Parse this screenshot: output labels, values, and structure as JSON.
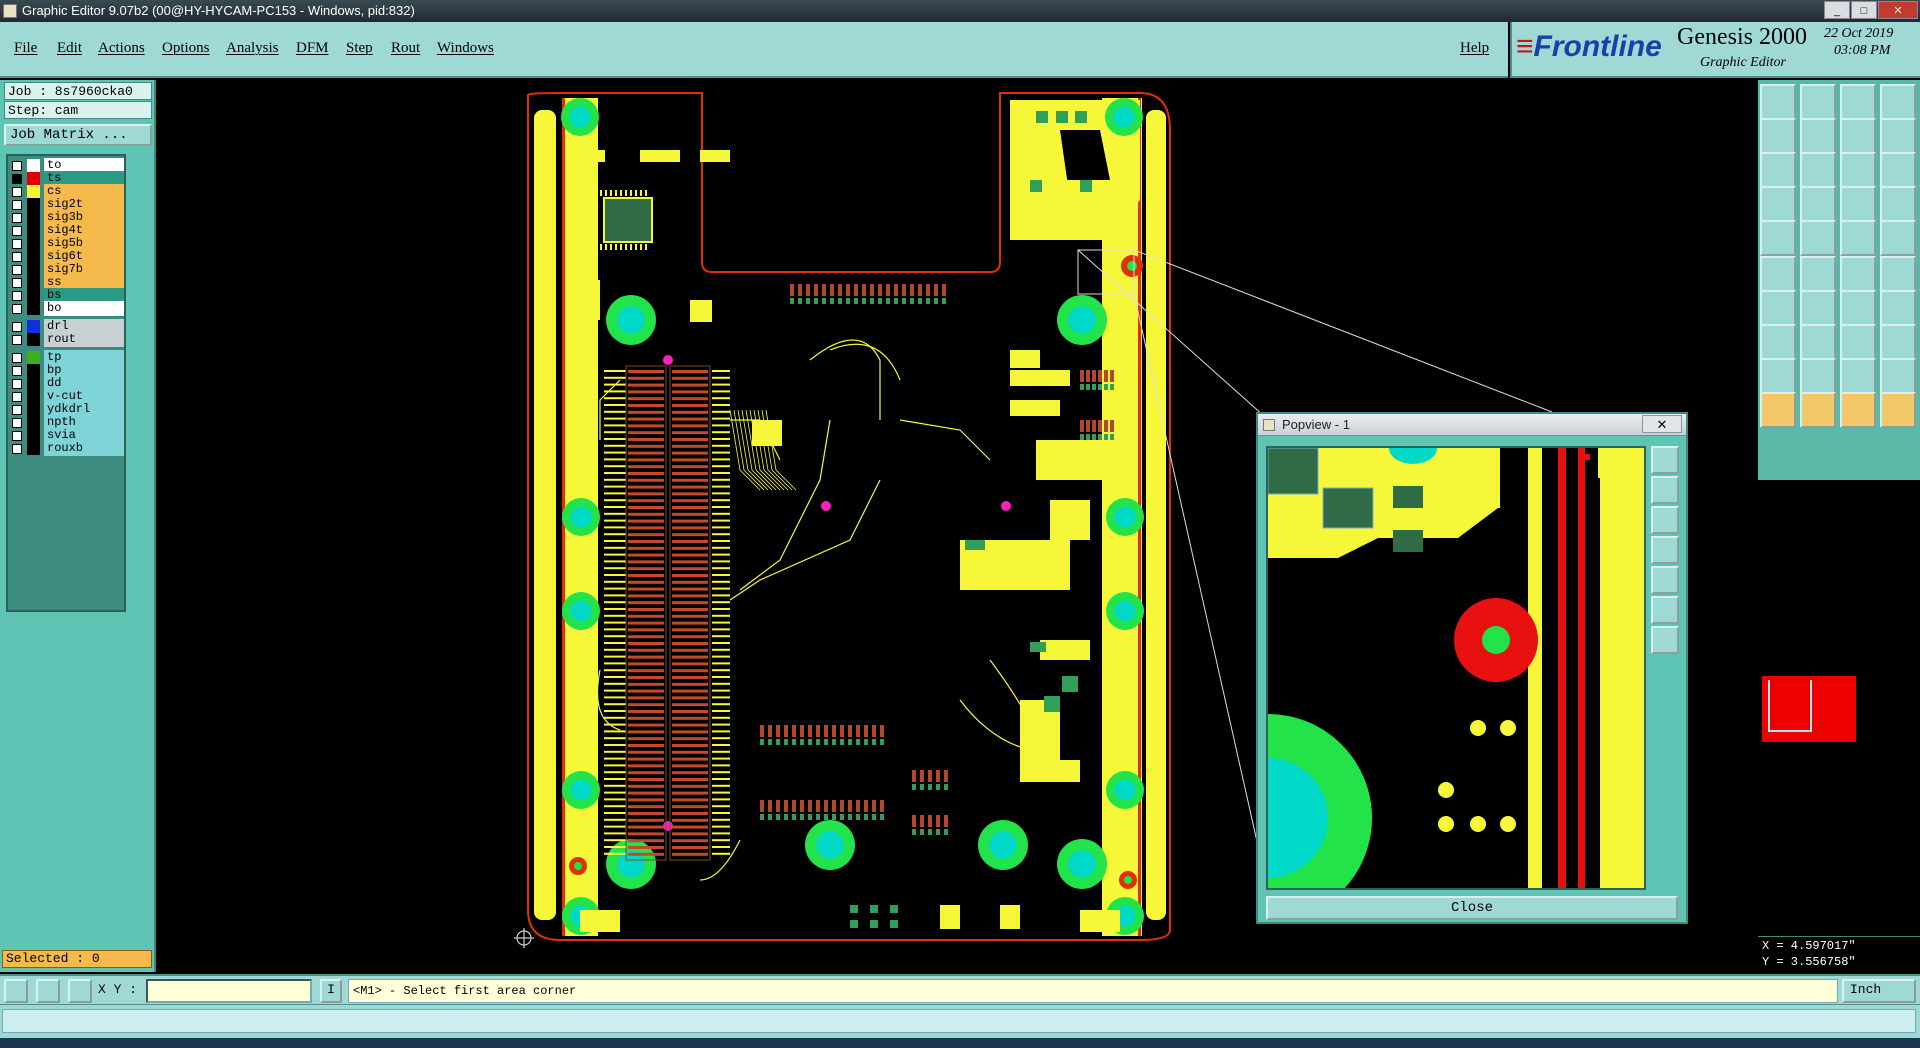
{
  "window": {
    "title": "Graphic Editor 9.07b2 (00@HY-HYCAM-PC153 - Windows, pid:832)",
    "controls": [
      "_",
      "□",
      "✕"
    ]
  },
  "menu": {
    "items": [
      "File",
      "Edit",
      "Actions",
      "Options",
      "Analysis",
      "DFM",
      "Step",
      "Rout",
      "Windows"
    ],
    "help": "Help"
  },
  "brand": {
    "logo": "Frontline",
    "product": "Genesis 2000",
    "subtitle": "Graphic Editor",
    "date": "22 Oct 2019",
    "time": "03:08 PM"
  },
  "job": {
    "job_label": "Job : 8s7960cka0",
    "step_label": "Step: cam",
    "matrix_button": "Job Matrix ..."
  },
  "layers": [
    {
      "name": "to",
      "color": "#ffffff",
      "checked": false,
      "bg": "#ffffff"
    },
    {
      "name": "ts",
      "color": "#e00000",
      "checked": true,
      "bg": "#2a9a86"
    },
    {
      "name": "cs",
      "color": "#f5f532",
      "checked": false,
      "bg": "#f5b94c"
    },
    {
      "name": "sig2t",
      "color": "#000000",
      "checked": false,
      "bg": "#f5b94c"
    },
    {
      "name": "sig3b",
      "color": "#000000",
      "checked": false,
      "bg": "#f5b94c"
    },
    {
      "name": "sig4t",
      "color": "#000000",
      "checked": false,
      "bg": "#f5b94c"
    },
    {
      "name": "sig5b",
      "color": "#000000",
      "checked": false,
      "bg": "#f5b94c"
    },
    {
      "name": "sig6t",
      "color": "#000000",
      "checked": false,
      "bg": "#f5b94c"
    },
    {
      "name": "sig7b",
      "color": "#000000",
      "checked": false,
      "bg": "#f5b94c"
    },
    {
      "name": "ss",
      "color": "#000000",
      "checked": false,
      "bg": "#f5b94c"
    },
    {
      "name": "bs",
      "color": "#000000",
      "checked": false,
      "bg": "#2a9a86"
    },
    {
      "name": "bo",
      "color": "#000000",
      "checked": false,
      "bg": "#ffffff"
    },
    {
      "name": "drl",
      "color": "#1030e0",
      "checked": false,
      "bg": "#c7d0d2"
    },
    {
      "name": "rout",
      "color": "#000000",
      "checked": false,
      "bg": "#c7d0d2"
    },
    {
      "name": "tp",
      "color": "#3cb01c",
      "checked": false,
      "bg": "#7fd4d8"
    },
    {
      "name": "bp",
      "color": "#000000",
      "checked": false,
      "bg": "#7fd4d8"
    },
    {
      "name": "dd",
      "color": "#000000",
      "checked": false,
      "bg": "#7fd4d8"
    },
    {
      "name": "v-cut",
      "color": "#000000",
      "checked": false,
      "bg": "#7fd4d8"
    },
    {
      "name": "ydkdrl",
      "color": "#000000",
      "checked": false,
      "bg": "#7fd4d8"
    },
    {
      "name": "npth",
      "color": "#000000",
      "checked": false,
      "bg": "#7fd4d8"
    },
    {
      "name": "svia",
      "color": "#000000",
      "checked": false,
      "bg": "#7fd4d8"
    },
    {
      "name": "rouxb",
      "color": "#000000",
      "checked": false,
      "bg": "#7fd4d8"
    }
  ],
  "selected": "Selected : 0",
  "popview": {
    "title": "Popview - 1",
    "close_x": "✕",
    "close_button": "Close"
  },
  "coords": {
    "x": "X = 4.597017\"",
    "y": "Y = 3.556758\""
  },
  "status": {
    "xy_label": "X Y :",
    "xy_value": "",
    "i_button": "I",
    "prompt": "<M1> - Select first area corner",
    "units": "Inch"
  },
  "colors": {
    "copper": "#f7f73a",
    "pad_green": "#22e34a",
    "pad_cyan": "#00d8c8",
    "outline_red": "#e03000",
    "panel_teal": "#9fd9d6",
    "via_magenta": "#ff20c0"
  }
}
